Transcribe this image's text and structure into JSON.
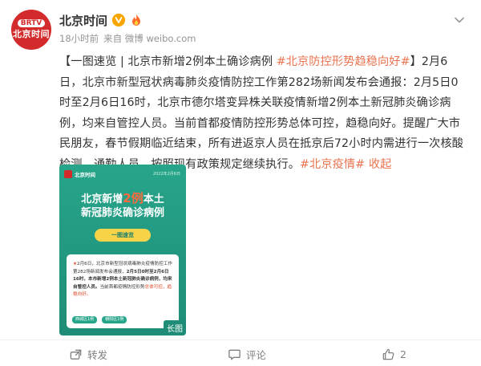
{
  "account": {
    "name": "北京时间",
    "avatar_top": "BRTV",
    "avatar_bottom": "北京时间"
  },
  "meta": {
    "time": "18小时前",
    "source": "来自 微博 weibo.com"
  },
  "post": {
    "p1": "【一图速览 | 北京市新增2例本土确诊病例 ",
    "tag1": "#北京防控形势趋稳向好#",
    "p2": "】2月6日，北京市新型冠状病毒肺炎疫情防控工作第282场新闻发布会通报：2月5日0时至2月6日16时，北京市德尔塔变异株关联疫情新增2例本土新冠肺炎确诊病例，均来自管控人员。当前首都疫情防控形势总体可控，趋稳向好。提醒广大市民朋友，春节假期临近结束，所有进返京人员在抵京后72小时内需进行一次核酸检测。通勤人员，按照现有政策规定继续执行。",
    "tag2": "#北京疫情#",
    "collapse": "收起"
  },
  "card": {
    "brand": "北京时间",
    "date": "2022年2月6日",
    "title_a": "北京新增",
    "title_num": "2例",
    "title_b": "本土",
    "title_line2": "新冠肺炎确诊病例",
    "pill": "一图速览",
    "panel_star": "★",
    "panel_text_1": "2月6日，北京市新型冠状病毒肺炎疫情防控工作第282场新闻发布会通报，",
    "panel_bold": "2月5日0时至2月6日16时，本市新增2例本土新冠肺炎确诊病例，均来自管控人员。",
    "panel_text_2": "当前首都疫情防控形势",
    "panel_red": "总体可控，趋稳向好。",
    "tag_left": "西城区1例",
    "tag_right": "朝阳区1例",
    "long_label": "长图"
  },
  "actions": {
    "share": "转发",
    "comment": "评论",
    "like_count": "2"
  },
  "colors": {
    "link": "#eb7350",
    "card_bg": "#27a58a",
    "brand_red": "#d32b2b"
  }
}
